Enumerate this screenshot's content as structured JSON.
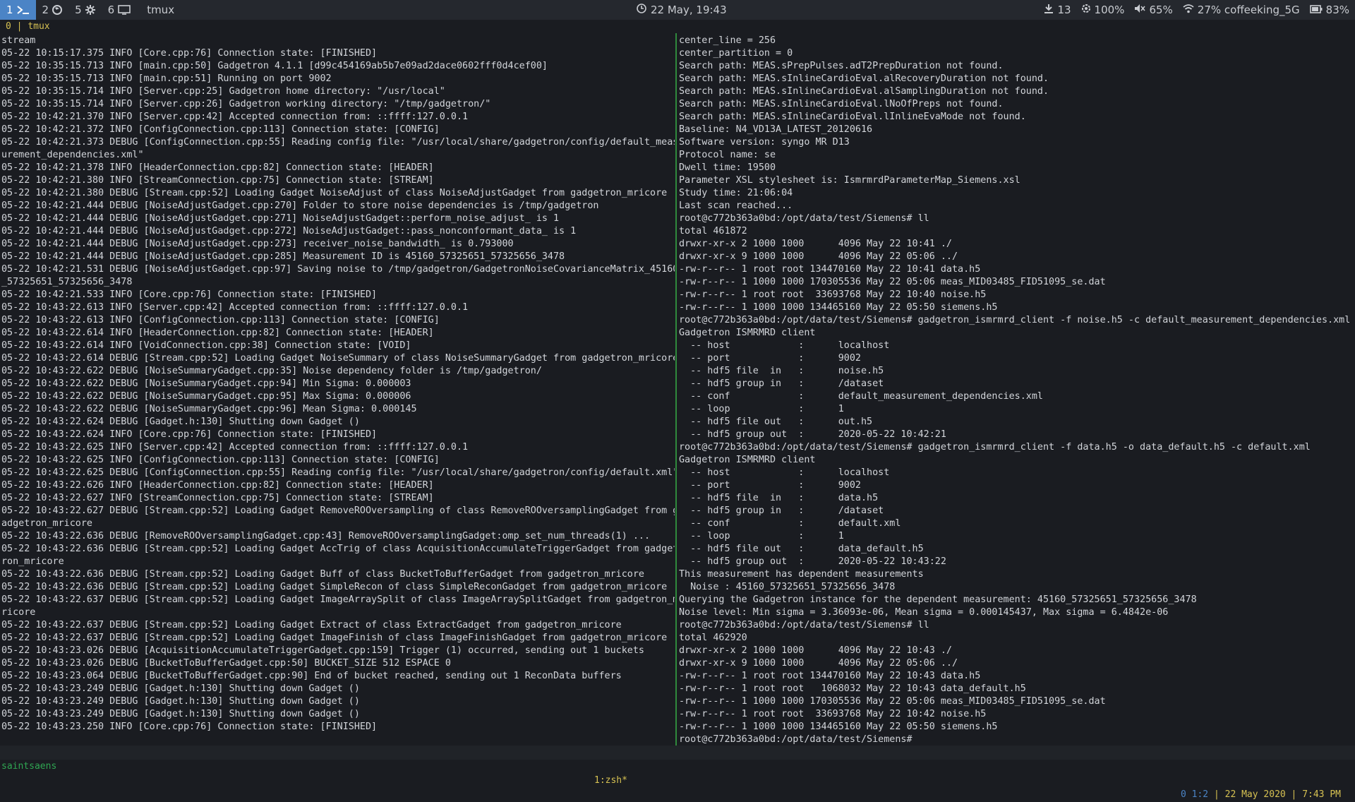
{
  "topbar": {
    "workspaces": [
      {
        "num": "1",
        "icon": "terminal-icon",
        "active": true
      },
      {
        "num": "2",
        "icon": "firefox-icon",
        "active": false
      },
      {
        "num": "5",
        "icon": "settings-icon",
        "active": false
      },
      {
        "num": "6",
        "icon": "monitor-icon",
        "active": false
      }
    ],
    "app_title": "tmux",
    "clock": "22 May, 19:43",
    "downloads": "13",
    "cpu": "100%",
    "volume": "65%",
    "wifi": "27% coffeeking_5G",
    "battery": "83%"
  },
  "session": {
    "index": "0",
    "separator": "|",
    "name": "tmux"
  },
  "left_pane": [
    "stream",
    "05-22 10:15:17.375 INFO [Core.cpp:76] Connection state: [FINISHED]",
    "05-22 10:35:15.713 INFO [main.cpp:50] Gadgetron 4.1.1 [d99c454169ab5b7e09ad2dace0602fff0d4cef00]",
    "05-22 10:35:15.713 INFO [main.cpp:51] Running on port 9002",
    "05-22 10:35:15.714 INFO [Server.cpp:25] Gadgetron home directory: \"/usr/local\"",
    "05-22 10:35:15.714 INFO [Server.cpp:26] Gadgetron working directory: \"/tmp/gadgetron/\"",
    "05-22 10:42:21.370 INFO [Server.cpp:42] Accepted connection from: ::ffff:127.0.0.1",
    "05-22 10:42:21.372 INFO [ConfigConnection.cpp:113] Connection state: [CONFIG]",
    "05-22 10:42:21.373 DEBUG [ConfigConnection.cpp:55] Reading config file: \"/usr/local/share/gadgetron/config/default_meas",
    "urement_dependencies.xml\"",
    "05-22 10:42:21.378 INFO [HeaderConnection.cpp:82] Connection state: [HEADER]",
    "05-22 10:42:21.380 INFO [StreamConnection.cpp:75] Connection state: [STREAM]",
    "05-22 10:42:21.380 DEBUG [Stream.cpp:52] Loading Gadget NoiseAdjust of class NoiseAdjustGadget from gadgetron_mricore",
    "05-22 10:42:21.444 DEBUG [NoiseAdjustGadget.cpp:270] Folder to store noise dependencies is /tmp/gadgetron",
    "05-22 10:42:21.444 DEBUG [NoiseAdjustGadget.cpp:271] NoiseAdjustGadget::perform_noise_adjust_ is 1",
    "05-22 10:42:21.444 DEBUG [NoiseAdjustGadget.cpp:272] NoiseAdjustGadget::pass_nonconformant_data_ is 1",
    "05-22 10:42:21.444 DEBUG [NoiseAdjustGadget.cpp:273] receiver_noise_bandwidth_ is 0.793000",
    "05-22 10:42:21.444 DEBUG [NoiseAdjustGadget.cpp:285] Measurement ID is 45160_57325651_57325656_3478",
    "05-22 10:42:21.531 DEBUG [NoiseAdjustGadget.cpp:97] Saving noise to /tmp/gadgetron/GadgetronNoiseCovarianceMatrix_45160",
    "_57325651_57325656_3478",
    "05-22 10:42:21.533 INFO [Core.cpp:76] Connection state: [FINISHED]",
    "05-22 10:43:22.613 INFO [Server.cpp:42] Accepted connection from: ::ffff:127.0.0.1",
    "05-22 10:43:22.613 INFO [ConfigConnection.cpp:113] Connection state: [CONFIG]",
    "05-22 10:43:22.614 INFO [HeaderConnection.cpp:82] Connection state: [HEADER]",
    "05-22 10:43:22.614 INFO [VoidConnection.cpp:38] Connection state: [VOID]",
    "05-22 10:43:22.614 DEBUG [Stream.cpp:52] Loading Gadget NoiseSummary of class NoiseSummaryGadget from gadgetron_mricore",
    "05-22 10:43:22.622 DEBUG [NoiseSummaryGadget.cpp:35] Noise dependency folder is /tmp/gadgetron/",
    "05-22 10:43:22.622 DEBUG [NoiseSummaryGadget.cpp:94] Min Sigma: 0.000003",
    "05-22 10:43:22.622 DEBUG [NoiseSummaryGadget.cpp:95] Max Sigma: 0.000006",
    "05-22 10:43:22.622 DEBUG [NoiseSummaryGadget.cpp:96] Mean Sigma: 0.000145",
    "05-22 10:43:22.624 DEBUG [Gadget.h:130] Shutting down Gadget ()",
    "05-22 10:43:22.624 INFO [Core.cpp:76] Connection state: [FINISHED]",
    "05-22 10:43:22.625 INFO [Server.cpp:42] Accepted connection from: ::ffff:127.0.0.1",
    "05-22 10:43:22.625 INFO [ConfigConnection.cpp:113] Connection state: [CONFIG]",
    "05-22 10:43:22.625 DEBUG [ConfigConnection.cpp:55] Reading config file: \"/usr/local/share/gadgetron/config/default.xml\"",
    "05-22 10:43:22.626 INFO [HeaderConnection.cpp:82] Connection state: [HEADER]",
    "05-22 10:43:22.627 INFO [StreamConnection.cpp:75] Connection state: [STREAM]",
    "05-22 10:43:22.627 DEBUG [Stream.cpp:52] Loading Gadget RemoveROOversampling of class RemoveROOversamplingGadget from g",
    "adgetron_mricore",
    "05-22 10:43:22.636 DEBUG [RemoveROOversamplingGadget.cpp:43] RemoveROOversamplingGadget:omp_set_num_threads(1) ...",
    "05-22 10:43:22.636 DEBUG [Stream.cpp:52] Loading Gadget AccTrig of class AcquisitionAccumulateTriggerGadget from gadget",
    "ron_mricore",
    "05-22 10:43:22.636 DEBUG [Stream.cpp:52] Loading Gadget Buff of class BucketToBufferGadget from gadgetron_mricore",
    "05-22 10:43:22.636 DEBUG [Stream.cpp:52] Loading Gadget SimpleRecon of class SimpleReconGadget from gadgetron_mricore",
    "05-22 10:43:22.637 DEBUG [Stream.cpp:52] Loading Gadget ImageArraySplit of class ImageArraySplitGadget from gadgetron_m",
    "ricore",
    "05-22 10:43:22.637 DEBUG [Stream.cpp:52] Loading Gadget Extract of class ExtractGadget from gadgetron_mricore",
    "05-22 10:43:22.637 DEBUG [Stream.cpp:52] Loading Gadget ImageFinish of class ImageFinishGadget from gadgetron_mricore",
    "05-22 10:43:23.026 DEBUG [AcquisitionAccumulateTriggerGadget.cpp:159] Trigger (1) occurred, sending out 1 buckets",
    "05-22 10:43:23.026 DEBUG [BucketToBufferGadget.cpp:50] BUCKET_SIZE 512 ESPACE 0",
    "05-22 10:43:23.064 DEBUG [BucketToBufferGadget.cpp:90] End of bucket reached, sending out 1 ReconData buffers",
    "05-22 10:43:23.249 DEBUG [Gadget.h:130] Shutting down Gadget ()",
    "05-22 10:43:23.249 DEBUG [Gadget.h:130] Shutting down Gadget ()",
    "05-22 10:43:23.249 DEBUG [Gadget.h:130] Shutting down Gadget ()",
    "05-22 10:43:23.250 INFO [Core.cpp:76] Connection state: [FINISHED]"
  ],
  "right_pane": [
    "center_line = 256",
    "center_partition = 0",
    "Search path: MEAS.sPrepPulses.adT2PrepDuration not found.",
    "Search path: MEAS.sInlineCardioEval.alRecoveryDuration not found.",
    "Search path: MEAS.sInlineCardioEval.alSamplingDuration not found.",
    "Search path: MEAS.sInlineCardioEval.lNoOfPreps not found.",
    "Search path: MEAS.sInlineCardioEval.lInlineEvaMode not found.",
    "Baseline: N4_VD13A_LATEST_20120616",
    "Software version: syngo MR D13",
    "Protocol name: se",
    "Dwell time: 19500",
    "Parameter XSL stylesheet is: IsmrmrdParameterMap_Siemens.xsl",
    "Study time: 21:06:04",
    "Last scan reached...",
    "root@c772b363a0bd:/opt/data/test/Siemens# ll",
    "total 461872",
    "drwxr-xr-x 2 1000 1000      4096 May 22 10:41 ./",
    "drwxr-xr-x 9 1000 1000      4096 May 22 05:06 ../",
    "-rw-r--r-- 1 root root 134470160 May 22 10:41 data.h5",
    "-rw-r--r-- 1 1000 1000 170305536 May 22 05:06 meas_MID03485_FID51095_se.dat",
    "-rw-r--r-- 1 root root  33693768 May 22 10:40 noise.h5",
    "-rw-r--r-- 1 1000 1000 134465160 May 22 05:50 siemens.h5",
    "root@c772b363a0bd:/opt/data/test/Siemens# gadgetron_ismrmrd_client -f noise.h5 -c default_measurement_dependencies.xml",
    "Gadgetron ISMRMRD client",
    "  -- host            :      localhost",
    "  -- port            :      9002",
    "  -- hdf5 file  in   :      noise.h5",
    "  -- hdf5 group in   :      /dataset",
    "  -- conf            :      default_measurement_dependencies.xml",
    "  -- loop            :      1",
    "  -- hdf5 file out   :      out.h5",
    "  -- hdf5 group out  :      2020-05-22 10:42:21",
    "root@c772b363a0bd:/opt/data/test/Siemens# gadgetron_ismrmrd_client -f data.h5 -o data_default.h5 -c default.xml",
    "Gadgetron ISMRMRD client",
    "  -- host            :      localhost",
    "  -- port            :      9002",
    "  -- hdf5 file  in   :      data.h5",
    "  -- hdf5 group in   :      /dataset",
    "  -- conf            :      default.xml",
    "  -- loop            :      1",
    "  -- hdf5 file out   :      data_default.h5",
    "  -- hdf5 group out  :      2020-05-22 10:43:22",
    "This measurement has dependent measurements",
    "  Noise : 45160_57325651_57325656_3478",
    "Querying the Gadgetron instance for the dependent measurement: 45160_57325651_57325656_3478",
    "Noise level: Min sigma = 3.36093e-06, Mean sigma = 0.000145437, Max sigma = 6.4842e-06",
    "root@c772b363a0bd:/opt/data/test/Siemens# ll",
    "total 462920",
    "drwxr-xr-x 2 1000 1000      4096 May 22 10:43 ./",
    "drwxr-xr-x 9 1000 1000      4096 May 22 05:06 ../",
    "-rw-r--r-- 1 root root 134470160 May 22 10:43 data.h5",
    "-rw-r--r-- 1 root root   1068032 May 22 10:43 data_default.h5",
    "-rw-r--r-- 1 1000 1000 170305536 May 22 05:06 meas_MID03485_FID51095_se.dat",
    "-rw-r--r-- 1 root root  33693768 May 22 10:42 noise.h5",
    "-rw-r--r-- 1 1000 1000 134465160 May 22 05:50 siemens.h5",
    "root@c772b363a0bd:/opt/data/test/Siemens# "
  ],
  "tmux_status": {
    "host": "saintsaens",
    "window": "1:zsh*",
    "pane_pos": "0 1:2",
    "date": "22 May 2020",
    "time": "7:43 PM",
    "separator": "|"
  },
  "colors": {
    "accent": "#4b84c6",
    "divider": "#2f8a3c",
    "status_yellow": "#d6c152",
    "host_green": "#2fa552"
  }
}
